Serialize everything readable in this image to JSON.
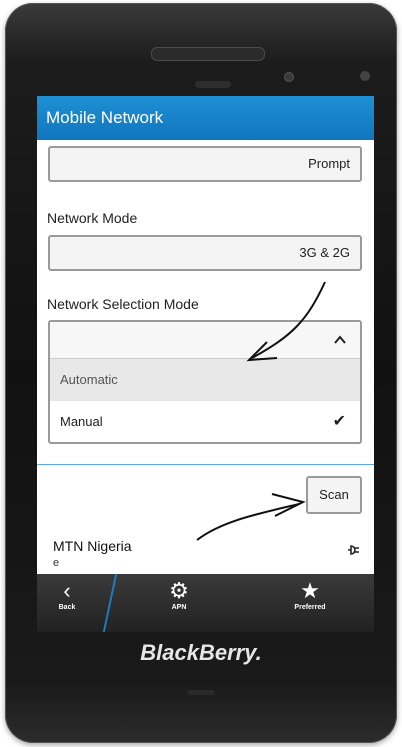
{
  "titlebar": {
    "title": "Mobile Network"
  },
  "fields": {
    "prompt_value": "Prompt",
    "network_mode_label": "Network Mode",
    "network_mode_value": "3G & 2G",
    "selection_mode_label": "Network Selection Mode"
  },
  "dropdown": {
    "options": [
      {
        "label": "Automatic",
        "highlighted": true
      },
      {
        "label": "Manual",
        "checked": true
      }
    ]
  },
  "scan": {
    "label": "Scan"
  },
  "network": {
    "name": "MTN Nigeria",
    "sub": "e"
  },
  "actionbar": {
    "back": "Back",
    "apn": "APN",
    "preferred": "Preferred"
  },
  "brand": {
    "text": "BlackBerry."
  },
  "colors": {
    "accent": "#1a86cc",
    "action_bar": "#2a2a2a"
  }
}
